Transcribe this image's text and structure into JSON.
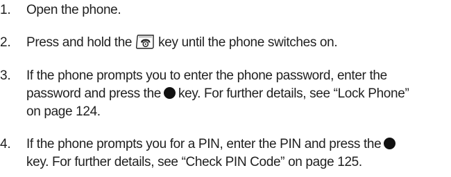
{
  "steps": [
    {
      "number": "1.",
      "text": "Open the phone."
    },
    {
      "number": "2.",
      "text_before": "Press and hold the",
      "icon": "power-end-key-icon",
      "text_after": "key until the phone switches on."
    },
    {
      "number": "3.",
      "line1": "If the phone prompts you to enter the phone password, enter the",
      "line2_before": "password and press the",
      "icon": "ok-key-icon",
      "line2_after": "key. For further details, see “Lock Phone”",
      "line3": "on page 124."
    },
    {
      "number": "4.",
      "line1_before": "If the phone prompts you for a PIN, enter the PIN and press the",
      "icon": "ok-key-icon",
      "line2": "key. For further details, see “Check PIN Code” on page 125."
    }
  ]
}
